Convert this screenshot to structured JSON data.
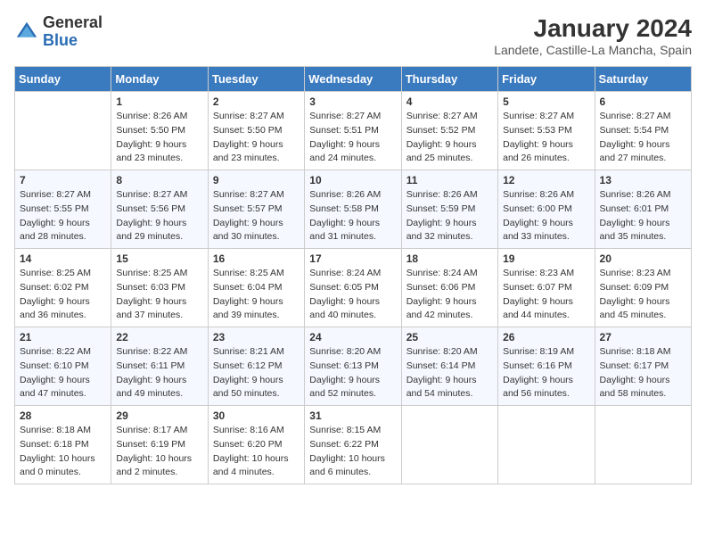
{
  "header": {
    "logo_general": "General",
    "logo_blue": "Blue",
    "month_year": "January 2024",
    "location": "Landete, Castille-La Mancha, Spain"
  },
  "days_of_week": [
    "Sunday",
    "Monday",
    "Tuesday",
    "Wednesday",
    "Thursday",
    "Friday",
    "Saturday"
  ],
  "weeks": [
    [
      {
        "day": "",
        "info": ""
      },
      {
        "day": "1",
        "info": "Sunrise: 8:26 AM\nSunset: 5:50 PM\nDaylight: 9 hours\nand 23 minutes."
      },
      {
        "day": "2",
        "info": "Sunrise: 8:27 AM\nSunset: 5:50 PM\nDaylight: 9 hours\nand 23 minutes."
      },
      {
        "day": "3",
        "info": "Sunrise: 8:27 AM\nSunset: 5:51 PM\nDaylight: 9 hours\nand 24 minutes."
      },
      {
        "day": "4",
        "info": "Sunrise: 8:27 AM\nSunset: 5:52 PM\nDaylight: 9 hours\nand 25 minutes."
      },
      {
        "day": "5",
        "info": "Sunrise: 8:27 AM\nSunset: 5:53 PM\nDaylight: 9 hours\nand 26 minutes."
      },
      {
        "day": "6",
        "info": "Sunrise: 8:27 AM\nSunset: 5:54 PM\nDaylight: 9 hours\nand 27 minutes."
      }
    ],
    [
      {
        "day": "7",
        "info": "Sunrise: 8:27 AM\nSunset: 5:55 PM\nDaylight: 9 hours\nand 28 minutes."
      },
      {
        "day": "8",
        "info": "Sunrise: 8:27 AM\nSunset: 5:56 PM\nDaylight: 9 hours\nand 29 minutes."
      },
      {
        "day": "9",
        "info": "Sunrise: 8:27 AM\nSunset: 5:57 PM\nDaylight: 9 hours\nand 30 minutes."
      },
      {
        "day": "10",
        "info": "Sunrise: 8:26 AM\nSunset: 5:58 PM\nDaylight: 9 hours\nand 31 minutes."
      },
      {
        "day": "11",
        "info": "Sunrise: 8:26 AM\nSunset: 5:59 PM\nDaylight: 9 hours\nand 32 minutes."
      },
      {
        "day": "12",
        "info": "Sunrise: 8:26 AM\nSunset: 6:00 PM\nDaylight: 9 hours\nand 33 minutes."
      },
      {
        "day": "13",
        "info": "Sunrise: 8:26 AM\nSunset: 6:01 PM\nDaylight: 9 hours\nand 35 minutes."
      }
    ],
    [
      {
        "day": "14",
        "info": "Sunrise: 8:25 AM\nSunset: 6:02 PM\nDaylight: 9 hours\nand 36 minutes."
      },
      {
        "day": "15",
        "info": "Sunrise: 8:25 AM\nSunset: 6:03 PM\nDaylight: 9 hours\nand 37 minutes."
      },
      {
        "day": "16",
        "info": "Sunrise: 8:25 AM\nSunset: 6:04 PM\nDaylight: 9 hours\nand 39 minutes."
      },
      {
        "day": "17",
        "info": "Sunrise: 8:24 AM\nSunset: 6:05 PM\nDaylight: 9 hours\nand 40 minutes."
      },
      {
        "day": "18",
        "info": "Sunrise: 8:24 AM\nSunset: 6:06 PM\nDaylight: 9 hours\nand 42 minutes."
      },
      {
        "day": "19",
        "info": "Sunrise: 8:23 AM\nSunset: 6:07 PM\nDaylight: 9 hours\nand 44 minutes."
      },
      {
        "day": "20",
        "info": "Sunrise: 8:23 AM\nSunset: 6:09 PM\nDaylight: 9 hours\nand 45 minutes."
      }
    ],
    [
      {
        "day": "21",
        "info": "Sunrise: 8:22 AM\nSunset: 6:10 PM\nDaylight: 9 hours\nand 47 minutes."
      },
      {
        "day": "22",
        "info": "Sunrise: 8:22 AM\nSunset: 6:11 PM\nDaylight: 9 hours\nand 49 minutes."
      },
      {
        "day": "23",
        "info": "Sunrise: 8:21 AM\nSunset: 6:12 PM\nDaylight: 9 hours\nand 50 minutes."
      },
      {
        "day": "24",
        "info": "Sunrise: 8:20 AM\nSunset: 6:13 PM\nDaylight: 9 hours\nand 52 minutes."
      },
      {
        "day": "25",
        "info": "Sunrise: 8:20 AM\nSunset: 6:14 PM\nDaylight: 9 hours\nand 54 minutes."
      },
      {
        "day": "26",
        "info": "Sunrise: 8:19 AM\nSunset: 6:16 PM\nDaylight: 9 hours\nand 56 minutes."
      },
      {
        "day": "27",
        "info": "Sunrise: 8:18 AM\nSunset: 6:17 PM\nDaylight: 9 hours\nand 58 minutes."
      }
    ],
    [
      {
        "day": "28",
        "info": "Sunrise: 8:18 AM\nSunset: 6:18 PM\nDaylight: 10 hours\nand 0 minutes."
      },
      {
        "day": "29",
        "info": "Sunrise: 8:17 AM\nSunset: 6:19 PM\nDaylight: 10 hours\nand 2 minutes."
      },
      {
        "day": "30",
        "info": "Sunrise: 8:16 AM\nSunset: 6:20 PM\nDaylight: 10 hours\nand 4 minutes."
      },
      {
        "day": "31",
        "info": "Sunrise: 8:15 AM\nSunset: 6:22 PM\nDaylight: 10 hours\nand 6 minutes."
      },
      {
        "day": "",
        "info": ""
      },
      {
        "day": "",
        "info": ""
      },
      {
        "day": "",
        "info": ""
      }
    ]
  ]
}
